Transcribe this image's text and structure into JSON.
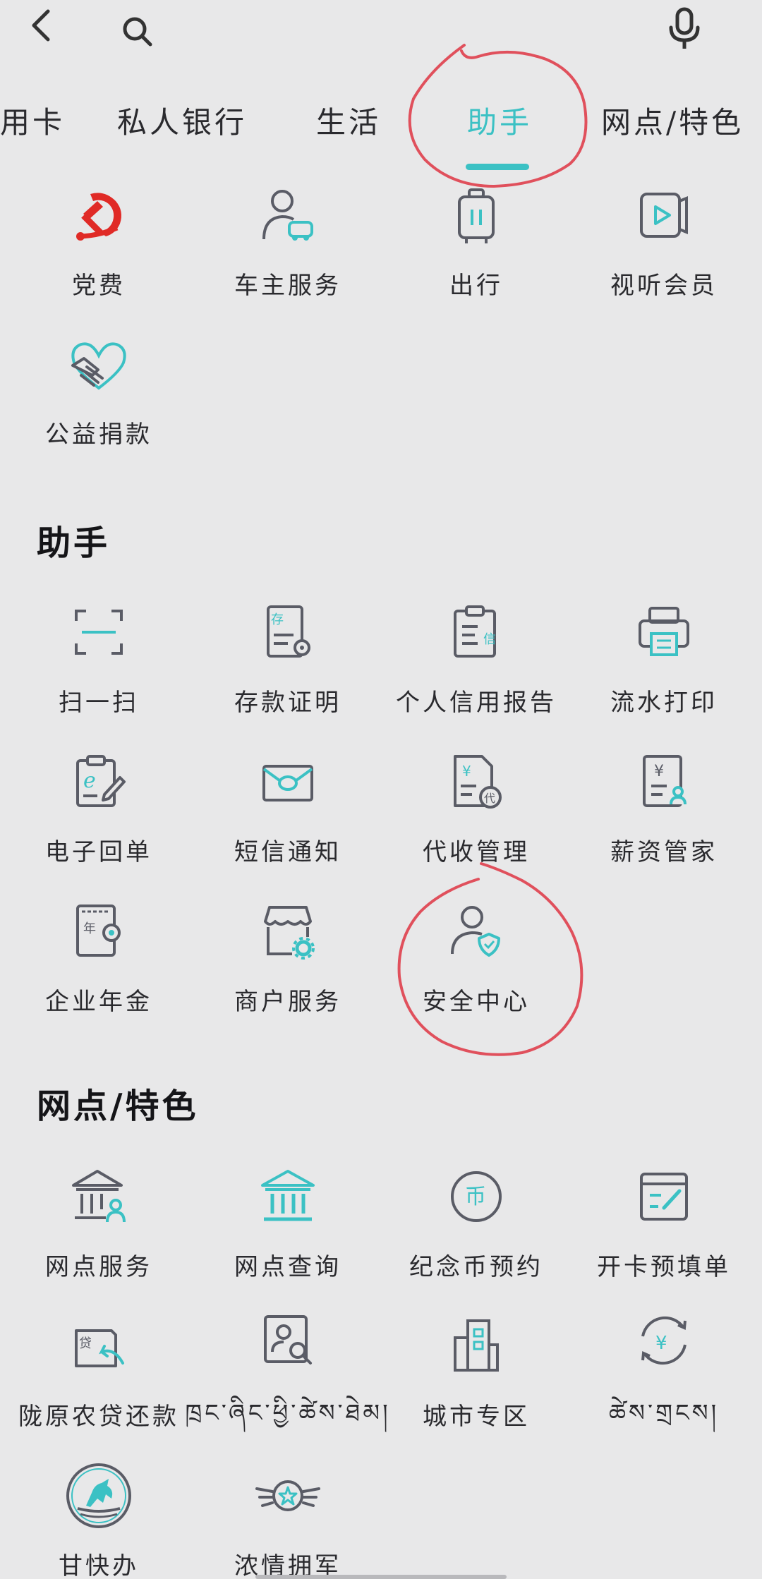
{
  "header": {
    "back_icon": "chevron-left-icon",
    "search_icon": "search-icon",
    "mic_icon": "microphone-icon"
  },
  "tabs": [
    {
      "label": "用卡",
      "active": false
    },
    {
      "label": "私人银行",
      "active": false
    },
    {
      "label": "生活",
      "active": false
    },
    {
      "label": "助手",
      "active": true
    },
    {
      "label": "网点/特色",
      "active": false
    }
  ],
  "life_section": {
    "items": [
      {
        "label": "党费",
        "icon": "party-emblem-icon"
      },
      {
        "label": "车主服务",
        "icon": "car-owner-icon"
      },
      {
        "label": "出行",
        "icon": "luggage-icon"
      },
      {
        "label": "视听会员",
        "icon": "video-play-icon"
      },
      {
        "label": "公益捐款",
        "icon": "charity-handshake-icon"
      }
    ]
  },
  "assistant_section": {
    "title": "助手",
    "items": [
      {
        "label": "扫一扫",
        "icon": "scan-icon"
      },
      {
        "label": "存款证明",
        "icon": "deposit-certificate-icon"
      },
      {
        "label": "个人信用报告",
        "icon": "credit-report-icon"
      },
      {
        "label": "流水打印",
        "icon": "printer-icon"
      },
      {
        "label": "电子回单",
        "icon": "e-receipt-icon"
      },
      {
        "label": "短信通知",
        "icon": "sms-envelope-icon"
      },
      {
        "label": "代收管理",
        "icon": "collection-management-icon"
      },
      {
        "label": "薪资管家",
        "icon": "salary-icon"
      },
      {
        "label": "企业年金",
        "icon": "annuity-icon"
      },
      {
        "label": "商户服务",
        "icon": "merchant-store-icon"
      },
      {
        "label": "安全中心",
        "icon": "security-user-shield-icon"
      }
    ]
  },
  "outlet_section": {
    "title": "网点/特色",
    "items": [
      {
        "label": "网点服务",
        "icon": "bank-branch-user-icon"
      },
      {
        "label": "网点查询",
        "icon": "bank-building-icon"
      },
      {
        "label": "纪念币预约",
        "icon": "coin-icon"
      },
      {
        "label": "开卡预填单",
        "icon": "form-edit-icon"
      },
      {
        "label": "陇原农贷还款",
        "icon": "loan-repay-icon"
      },
      {
        "label": "ཁྲང་ཞིང་ཕྱི་ཚེས་ཐེམ།",
        "icon": "profile-search-icon"
      },
      {
        "label": "城市专区",
        "icon": "city-building-icon"
      },
      {
        "label": "ཚེས་གྲངས།",
        "icon": "yuan-exchange-icon"
      },
      {
        "label": "甘快办",
        "icon": "horse-emblem-icon"
      },
      {
        "label": "浓情拥军",
        "icon": "military-star-icon"
      }
    ]
  },
  "colors": {
    "accent": "#3bc1c4",
    "icon_gray": "#5a5c66",
    "party_red": "#e02a26",
    "annotation_red": "#e0505c",
    "background": "#e8e8e9"
  }
}
